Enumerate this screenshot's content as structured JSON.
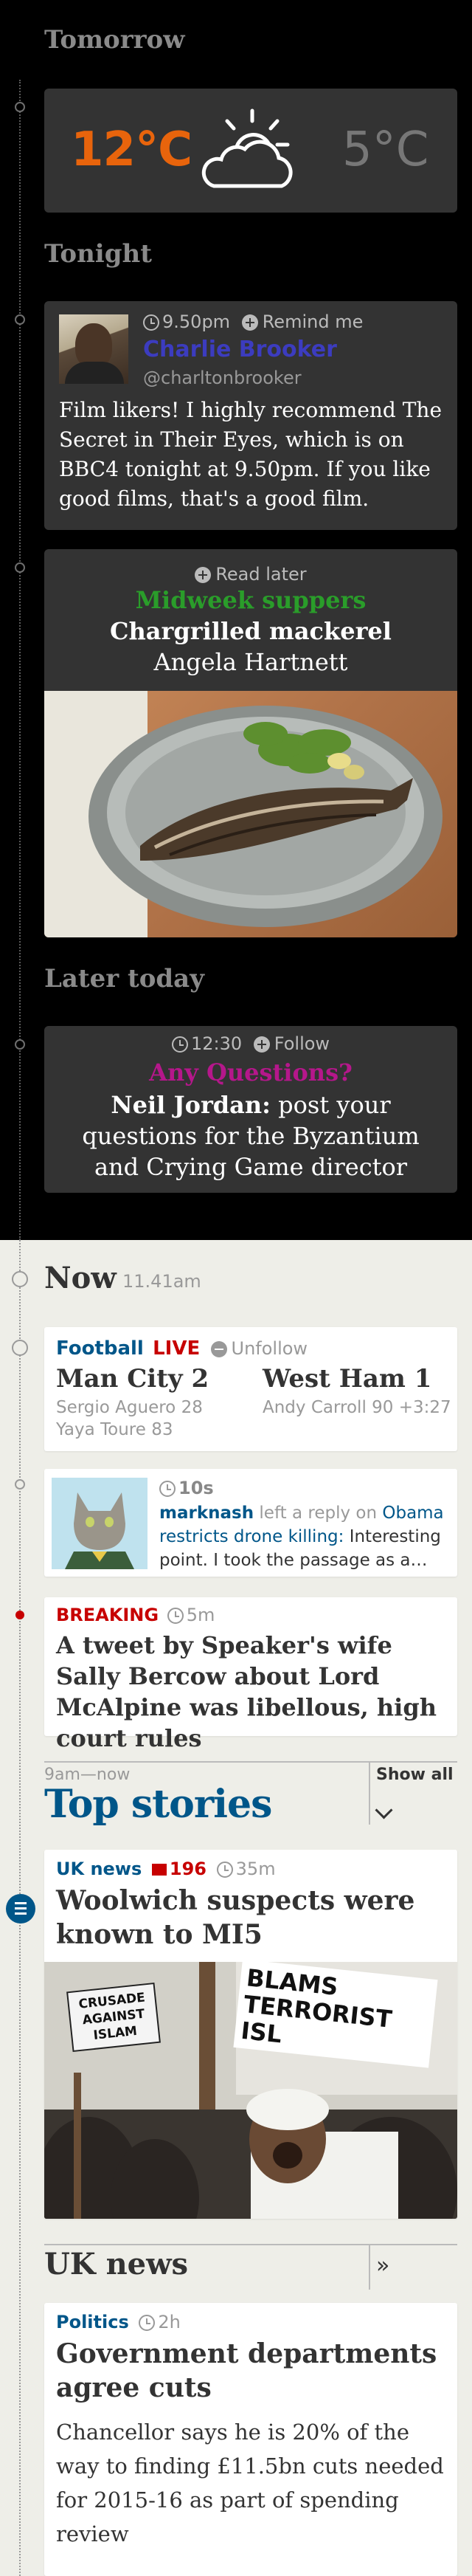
{
  "tomorrow": {
    "heading": "Tomorrow",
    "high": "12°C",
    "low": "5°C",
    "weather_icon": "partly-cloudy-icon",
    "high_color": "#e8640c"
  },
  "tonight": {
    "heading": "Tonight",
    "tweet": {
      "time": "9.50pm",
      "remind_label": "Remind me",
      "author": "Charlie Brooker",
      "handle": "@charltonbrooker",
      "text": "Film likers! I highly recommend The Secret in Their Eyes, which is on BBC4 tonight at 9.50pm. If you like good films, that's a good film."
    },
    "recipe": {
      "read_later_label": "Read later",
      "series": "Midweek suppers",
      "title": "Chargrilled mackerel",
      "author": "Angela Hartnett"
    }
  },
  "later_today": {
    "heading": "Later today",
    "event": {
      "time": "12:30",
      "follow_label": "Follow",
      "series": "Any Questions?",
      "name": "Neil Jordan:",
      "text": "post your questions for the Byzantium and Crying Game director"
    }
  },
  "now": {
    "heading": "Now",
    "time": "11.41am",
    "football": {
      "section": "Football",
      "live": "LIVE",
      "unfollow_label": "Unfollow",
      "home_team": "Man City 2",
      "home_scorers": [
        "Sergio Aguero 28",
        "Yaya Toure 83"
      ],
      "away_team": "West Ham 1",
      "away_scorers": [
        "Andy Carroll 90 +3:27"
      ]
    },
    "reply": {
      "age": "10s",
      "user": "marknash",
      "action": "left a reply on",
      "article": "Obama restricts drone killing:",
      "excerpt": "Interesting point. I took the passage as a…"
    },
    "breaking": {
      "label": "BREAKING",
      "age": "5m",
      "headline": "A tweet by Speaker's wife Sally Bercow about Lord McAlpine was libellous, high court rules"
    }
  },
  "top_stories": {
    "range": "9am—now",
    "heading": "Top stories",
    "show_all_label": "Show all",
    "story": {
      "section": "UK news",
      "comments": "196",
      "age": "35m",
      "headline": "Woolwich suspects were known to MI5",
      "sign_left": [
        "CRUSADE",
        "AGAINST",
        "ISLAM"
      ],
      "sign_right": "BLAMS TERRORIST ISL"
    }
  },
  "uk_news": {
    "heading": "UK news",
    "more_icon": "double-chevron-right-icon",
    "story": {
      "section": "Politics",
      "age": "2h",
      "headline": "Government departments agree cuts",
      "standfirst": "Chancellor says he is 20% of the way to finding £11.5bn cuts needed for 2015-16 as part of spending review"
    }
  },
  "colors": {
    "guardian_blue": "#005689",
    "live_red": "#c70000",
    "recipe_green": "#2a9d2a",
    "questions_magenta": "#b5178b",
    "author_blue": "#3c3cbf"
  }
}
